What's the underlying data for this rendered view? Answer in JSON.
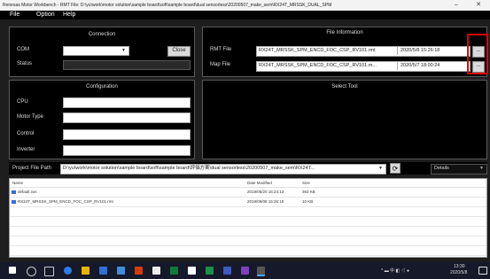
{
  "window": {
    "title": "Renesas Motor Workbench - RMT File: D:\\yu\\work\\motor solution\\sample board\\soft\\sample board\\dual sensorless\\20200507_make_sem\\RX24T_MRSSK_DUAL_SPM",
    "minimize": "–",
    "close": "✕"
  },
  "menu": {
    "file": "File",
    "option": "Option",
    "help": "Help"
  },
  "connection": {
    "title": "Connection",
    "com_label": "COM",
    "com_value": "",
    "close_button": "Close",
    "status_label": "Status",
    "status_value": ""
  },
  "file_info": {
    "title": "File Information",
    "rmt_label": "RMT File",
    "rmt_value": "RX24T_MRSSK_SPM_ENCD_FOC_CSP_RV101.rmt",
    "rmt_date": "2020/5/8 15:26:18",
    "map_label": "Map File",
    "map_value": "RX24T_MRSSK_SPM_ENCD_FOC_CSP_RV101.m...",
    "map_date": "2020/5/7 18:00:24",
    "browse": "..."
  },
  "configuration": {
    "title": "Configuration",
    "cpu_label": "CPU",
    "motor_type_label": "Motor Type",
    "control_label": "Control",
    "inverter_label": "Inverter"
  },
  "select_tool": {
    "title": "Select Tool"
  },
  "project": {
    "label": "Project File Path",
    "path": "D:\\yu\\work\\motor solution\\sample board\\soft\\sample board\\評価方案\\dual sensorless\\20200507_make_sem\\RX24T...",
    "view_option": "Details"
  },
  "file_list": {
    "columns": {
      "name": "Name",
      "date": "Date Modified",
      "size": "Size"
    },
    "rows": [
      {
        "name": "default.rwc",
        "date": "2019/05/20 16:24:13",
        "size": "363 KB"
      },
      {
        "name": "RX24T_MRSSK_SPM_ENCD_FOC_CSP_RV101.rmt",
        "date": "2019/09/08 15:26:18",
        "size": "10 KB"
      }
    ]
  },
  "taskbar": {
    "time": "13:30",
    "date": "2020/5/8"
  },
  "colors": {
    "highlight": "#e00000",
    "panel_bg": "#000000",
    "taskbar": "#16192a"
  }
}
